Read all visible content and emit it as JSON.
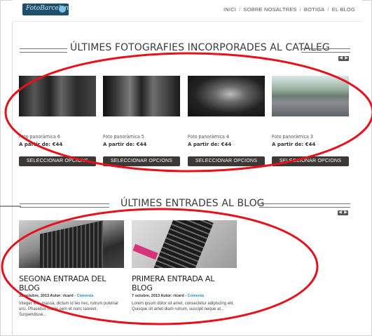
{
  "header": {
    "logo_text": "FotoBarcelona",
    "nav": [
      "INICI",
      "SOBRE NOSALTRES",
      "BOTIGA",
      "EL BLOG"
    ],
    "nav_separator": "/"
  },
  "catalog": {
    "title": "ÚLTIMES FOTOGRAFIES INCORPORADES AL CATALEG",
    "products": [
      {
        "name": "Foto panoràmica 6",
        "price": "A partir de: €44",
        "button": "SELECCIONAR OPCIONS"
      },
      {
        "name": "Foto panoràmica 5",
        "price": "A partir de: €44",
        "button": "SELECCIONAR OPCIONS"
      },
      {
        "name": "Foto panoràmica 4",
        "price": "A partir de: €44",
        "button": "SELECCIONAR OPCIONS"
      },
      {
        "name": "Foto panoràmica 3",
        "price": "A partir de: €44",
        "button": "SELECCIONAR OPCIONS"
      }
    ]
  },
  "blog": {
    "title": "ÚLTIMES ENTRADES AL BLOG",
    "posts": [
      {
        "title": "SEGONA ENTRADA DEL BLOG",
        "meta": "31 octubre, 2013 Autor: ricard -",
        "comment": "Comenta",
        "excerpt": "Integer felis massa, dictum id leo nec, rutrum pulvinar orci. Phasellus mollis sem et nunc laoreet. Suspendisse..."
      },
      {
        "title": "PRIMERA ENTRADA AL BLOG",
        "meta": "7 octubre, 2013 Autor: ricard -",
        "comment": "Comenta",
        "excerpt": "Lorem ipsum dolor sit amet, consectetur adipiscing elit. Quisque sit amet diam rutrum, suscipit neque at..."
      }
    ]
  },
  "colors": {
    "annotation_red": "#e8101a",
    "button_bg": "#3b3836",
    "comment_link": "#2d8fd5"
  }
}
